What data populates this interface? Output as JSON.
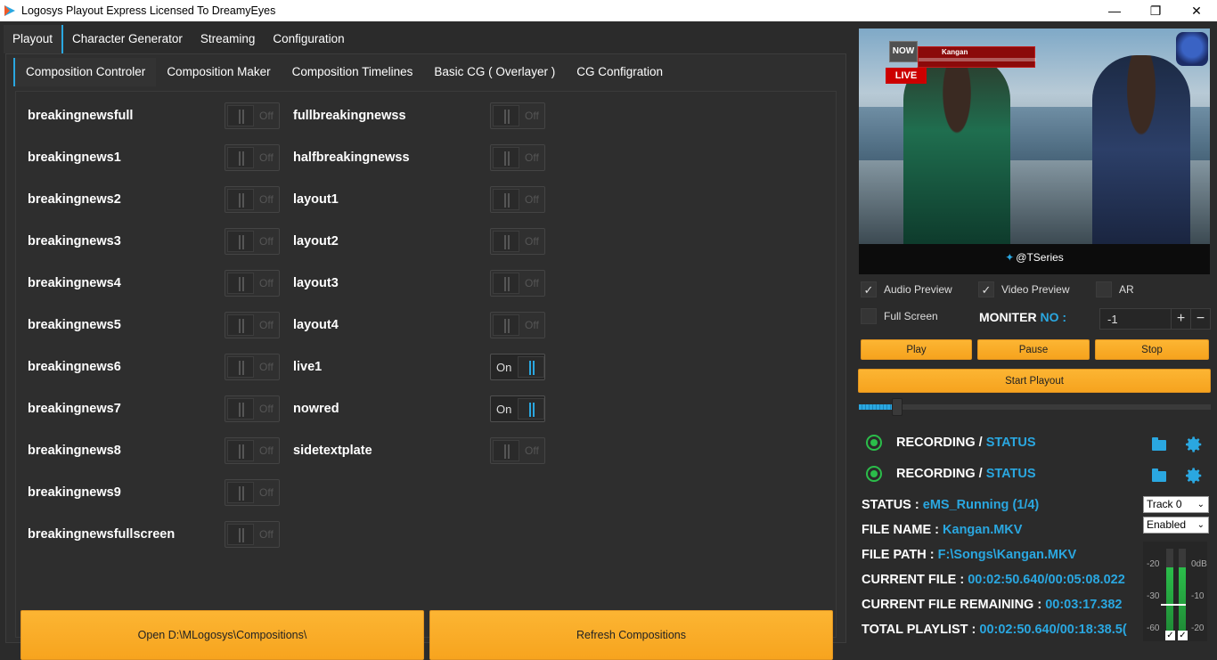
{
  "window": {
    "title": "Logosys Playout Express Licensed To DreamyEyes"
  },
  "main_tabs": [
    {
      "label": "Playout"
    },
    {
      "label": "Character Generator"
    },
    {
      "label": "Streaming"
    },
    {
      "label": "Configuration"
    }
  ],
  "sub_tabs": [
    {
      "label": "Composition Controler"
    },
    {
      "label": "Composition Maker"
    },
    {
      "label": "Composition Timelines"
    },
    {
      "label": "Basic CG ( Overlayer )"
    },
    {
      "label": "CG Configration"
    }
  ],
  "left_items": [
    {
      "label": "breakingnewsfull",
      "state": "Off"
    },
    {
      "label": "breakingnews1",
      "state": "Off"
    },
    {
      "label": "breakingnews2",
      "state": "Off"
    },
    {
      "label": "breakingnews3",
      "state": "Off"
    },
    {
      "label": "breakingnews4",
      "state": "Off"
    },
    {
      "label": "breakingnews5",
      "state": "Off"
    },
    {
      "label": "breakingnews6",
      "state": "Off"
    },
    {
      "label": "breakingnews7",
      "state": "Off"
    },
    {
      "label": "breakingnews8",
      "state": "Off"
    },
    {
      "label": "breakingnews9",
      "state": "Off"
    },
    {
      "label": "breakingnewsfullscreen",
      "state": "Off"
    }
  ],
  "right_items": [
    {
      "label": "fullbreakingnewss",
      "state": "Off"
    },
    {
      "label": "halfbreakingnewss",
      "state": "Off"
    },
    {
      "label": "layout1",
      "state": "Off"
    },
    {
      "label": "layout2",
      "state": "Off"
    },
    {
      "label": "layout3",
      "state": "Off"
    },
    {
      "label": "layout4",
      "state": "Off"
    },
    {
      "label": "live1",
      "state": "On"
    },
    {
      "label": "nowred",
      "state": "On"
    },
    {
      "label": "sidetextplate",
      "state": "Off"
    }
  ],
  "buttons": {
    "open": "Open D:\\MLogosys\\Compositions\\",
    "refresh": "Refresh Compositions"
  },
  "preview": {
    "now": "NOW",
    "live": "LIVE",
    "ticker_title": "Kangan",
    "handle": "@TSeries"
  },
  "options": {
    "audio_preview": "Audio Preview",
    "video_preview": "Video Preview",
    "ar": "AR",
    "full_screen": "Full Screen",
    "moniter_label": "MONITER",
    "moniter_no": "NO :",
    "moniter_value": "-1",
    "plus": "+",
    "minus": "−"
  },
  "controls": {
    "play": "Play",
    "pause": "Pause",
    "stop": "Stop",
    "start_playout": "Start Playout",
    "progress": 0.11
  },
  "recording": [
    {
      "label": "RECORDING /",
      "status": "STATUS"
    },
    {
      "label": "RECORDING /",
      "status": "STATUS"
    }
  ],
  "info": {
    "status_label": "STATUS :",
    "status_value": "eMS_Running (1/4)",
    "file_name_label": "FILE NAME :",
    "file_name_value": "Kangan.MKV",
    "file_path_label": "FILE PATH :",
    "file_path_value": "F:\\Songs\\Kangan.MKV",
    "current_file_label": "CURRENT FILE :",
    "current_file_value": "00:02:50.640/00:05:08.022",
    "remaining_label": "CURRENT FILE REMAINING :",
    "remaining_value": "00:03:17.382",
    "total_label": "TOTAL PLAYLIST :",
    "total_value": "00:02:50.640/00:18:38.5("
  },
  "audio": {
    "track": "Track 0",
    "enabled": "Enabled",
    "ticks": [
      "-20",
      "0dB",
      "-30",
      "-10",
      "-60",
      "-20"
    ],
    "levels": [
      0.78,
      0.78
    ]
  },
  "colors": {
    "accent": "#2aa7e0",
    "orange": "#fcb533",
    "green": "#2bbd4a"
  }
}
